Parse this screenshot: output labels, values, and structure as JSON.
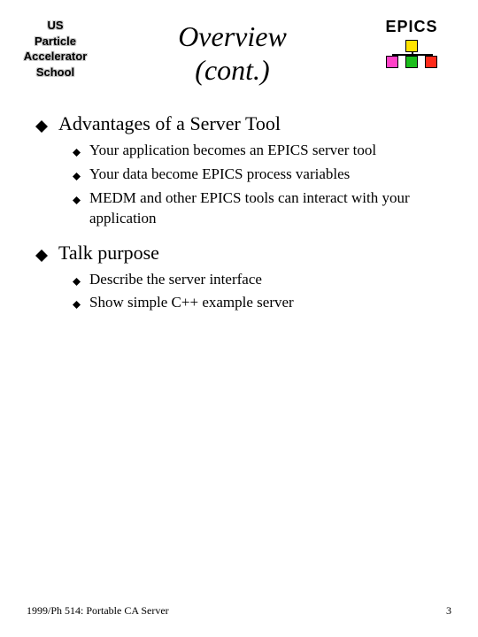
{
  "header": {
    "left_logo_lines": [
      "US",
      "Particle",
      "Accelerator",
      "School"
    ],
    "title_line1": "Overview",
    "title_line2": "(cont.)",
    "right_label": "EPICS"
  },
  "sections": [
    {
      "title": "Advantages of a Server Tool",
      "items": [
        "Your application becomes an EPICS server tool",
        "Your data become EPICS process variables",
        "MEDM and other EPICS tools can interact with your application"
      ]
    },
    {
      "title": "Talk purpose",
      "items": [
        "Describe the server interface",
        "Show simple C++ example server"
      ]
    }
  ],
  "footer": {
    "left": "1999/Ph 514: Portable CA Server",
    "right": "3"
  }
}
